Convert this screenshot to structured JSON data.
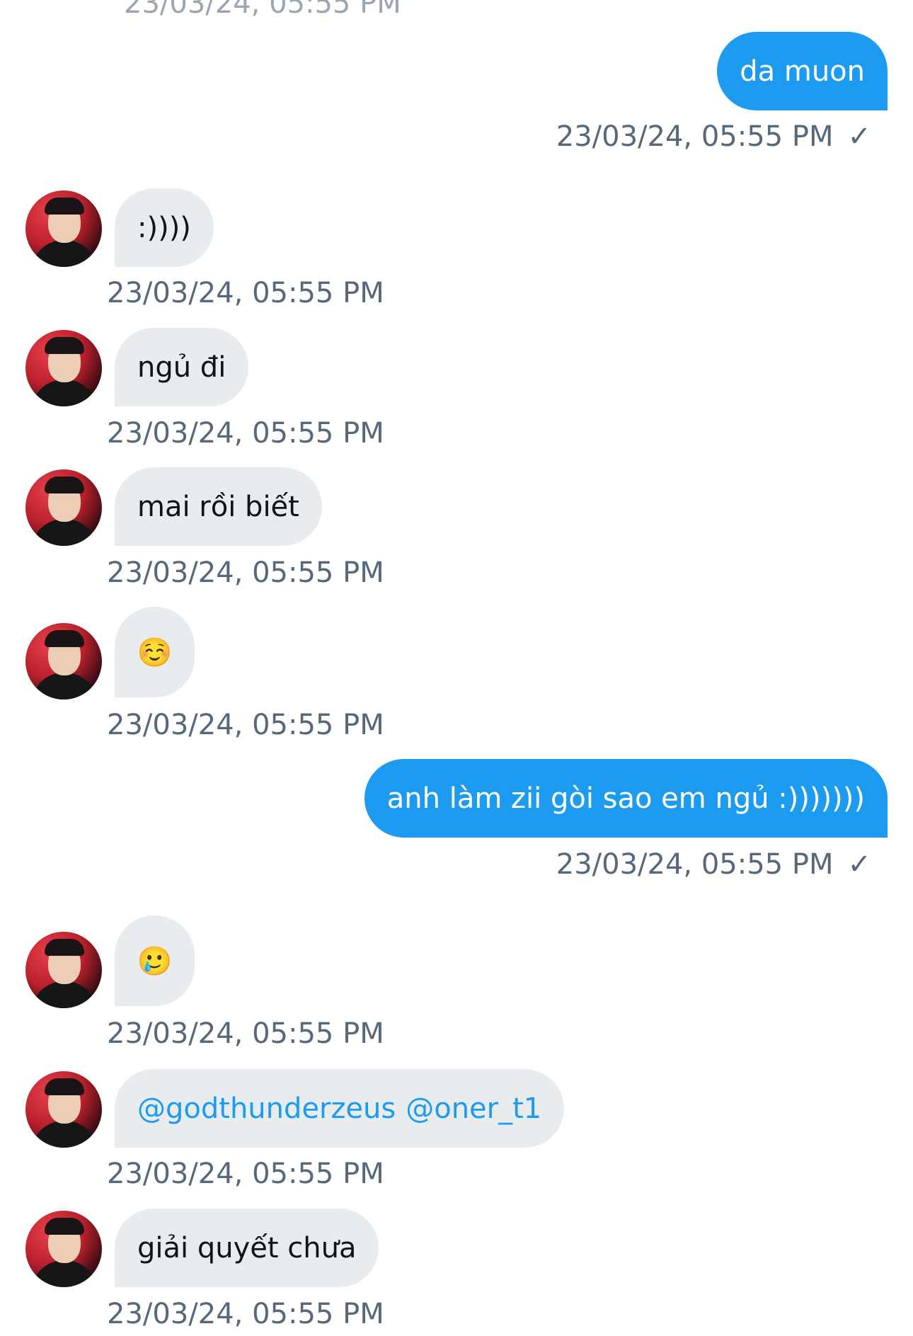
{
  "top_partial_text": "23/03/24, 05:55 PM",
  "messages": [
    {
      "dir": "out",
      "text": "da muon",
      "time": "23/03/24, 05:55 PM",
      "check": "✓"
    },
    {
      "dir": "in",
      "text": ":))))",
      "time": "23/03/24, 05:55 PM"
    },
    {
      "dir": "in",
      "text": "ngủ đi",
      "time": "23/03/24, 05:55 PM"
    },
    {
      "dir": "in",
      "text": "mai rồi biết",
      "time": "23/03/24, 05:55 PM"
    },
    {
      "dir": "in",
      "text": "☺️",
      "time": "23/03/24, 05:55 PM"
    },
    {
      "dir": "out",
      "text": "anh làm zii gòi sao em ngủ :)))))))",
      "time": "23/03/24, 05:55 PM",
      "check": "✓"
    },
    {
      "dir": "in",
      "text": "🥲",
      "time": "23/03/24, 05:55 PM"
    },
    {
      "dir": "in",
      "mention1": "@godthunderzeus",
      "mention2": "@oner_t1",
      "time": "23/03/24, 05:55 PM"
    },
    {
      "dir": "in",
      "text": "giải quyết chưa",
      "time": "23/03/24, 05:55 PM"
    }
  ],
  "colors": {
    "outgoing_bubble": "#1d9bf0",
    "incoming_bubble": "#e9ecef",
    "timestamp": "#56687a",
    "mention": "#1d9bf0"
  }
}
